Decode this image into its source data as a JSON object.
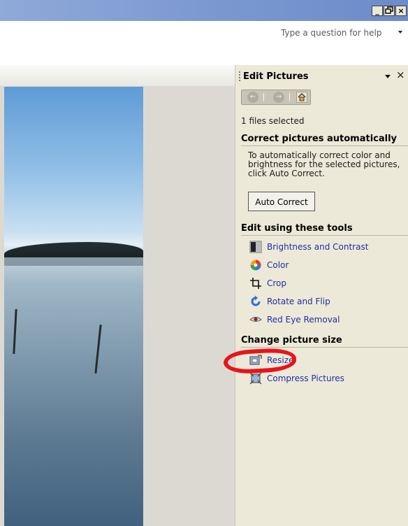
{
  "window": {
    "controls": [
      "_",
      "B",
      "X"
    ],
    "help_placeholder": "Type a question for help"
  },
  "task_pane": {
    "title": "Edit Pictures",
    "nav": {
      "back_icon": "back-arrow-icon",
      "forward_icon": "forward-arrow-icon",
      "home_icon": "home-icon"
    },
    "files_selected": "1 files selected",
    "correct": {
      "heading": "Correct pictures automatically",
      "description": "To automatically correct color and brightness for the selected pictures, click Auto Correct.",
      "button_label": "Auto Correct"
    },
    "edit_tools": {
      "heading": "Edit using these tools",
      "items": [
        {
          "label": "Brightness and Contrast",
          "icon": "brightness-contrast-icon"
        },
        {
          "label": "Color",
          "icon": "color-wheel-icon"
        },
        {
          "label": "Crop",
          "icon": "crop-icon"
        },
        {
          "label": "Rotate and Flip",
          "icon": "rotate-icon"
        },
        {
          "label": "Red Eye Removal",
          "icon": "eye-icon"
        }
      ]
    },
    "size": {
      "heading": "Change picture size",
      "items": [
        {
          "label": "Resize",
          "icon": "resize-icon"
        },
        {
          "label": "Compress Pictures",
          "icon": "compress-icon"
        }
      ]
    }
  },
  "colors": {
    "link": "#1f2fa0",
    "pane_bg": "#ece9d8",
    "annotation": "#e8141c"
  }
}
